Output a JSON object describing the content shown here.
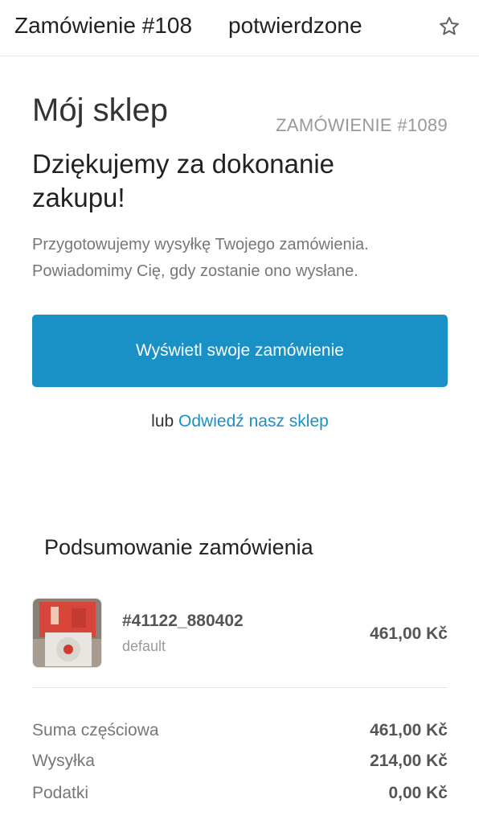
{
  "header": {
    "subject_part1": "Zamówienie #108",
    "subject_part2": "potwierdzone",
    "star_icon": "star-outline-icon"
  },
  "email": {
    "shop_name": "Mój sklep",
    "order_number": "ZAMÓWIENIE #1089",
    "thanks_heading": "Dziękujemy za dokonanie zakupu!",
    "description": "Przygotowujemy wysyłkę Twojego zamówienia. Powiadomimy Cię, gdy zostanie ono wysłane.",
    "view_order_button": "Wyświetl swoje zamówienie",
    "or_text": "lub",
    "visit_store_link": "Odwiedź nasz sklep",
    "button_color": "#1990c6",
    "link_color": "#1990c6"
  },
  "summary": {
    "title": "Podsumowanie zamówienia",
    "items": [
      {
        "name": "#41122_880402",
        "variant": "default",
        "price": "461,00 Kč"
      }
    ],
    "totals": [
      {
        "label": "Suma częściowa",
        "value": "461,00 Kč"
      },
      {
        "label": "Wysyłka",
        "value": "214,00 Kč"
      },
      {
        "label": "Podatki",
        "value": "0,00 Kč"
      }
    ]
  }
}
